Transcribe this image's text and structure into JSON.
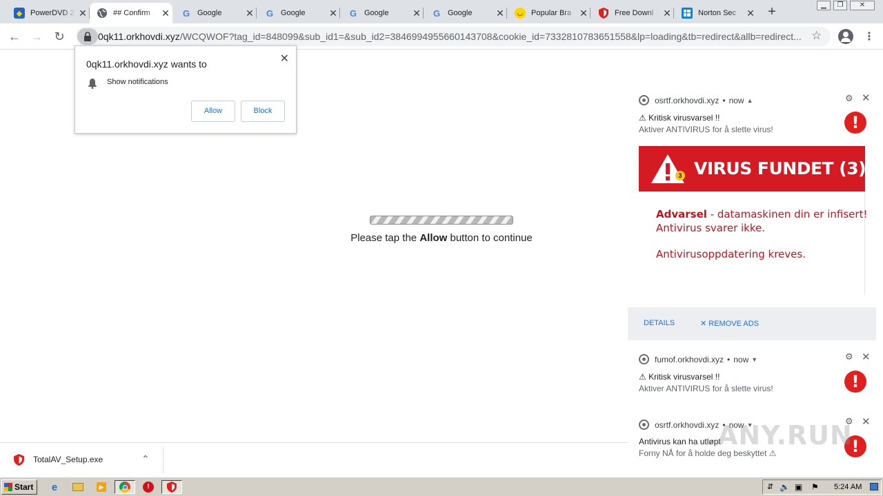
{
  "browser": {
    "tabs": [
      {
        "title": "PowerDVD 2",
        "icon": "powerdvd-icon"
      },
      {
        "title": "## Confirm",
        "icon": "globe-icon",
        "active": true
      },
      {
        "title": "Google",
        "icon": "google-icon"
      },
      {
        "title": "Google",
        "icon": "google-icon"
      },
      {
        "title": "Google",
        "icon": "google-icon"
      },
      {
        "title": "Google",
        "icon": "google-icon"
      },
      {
        "title": "Popular Bra",
        "icon": "smiley-icon"
      },
      {
        "title": "Free Downl",
        "icon": "shield-icon"
      },
      {
        "title": "Norton Sec",
        "icon": "windows-icon"
      }
    ],
    "new_tab": "+",
    "url": {
      "host": "0qk11.orkhovdi.xyz",
      "path": "/WCQWOF?tag_id=848099&sub_id1=&sub_id2=3846994955660143708&cookie_id=7332810783651558&lp=loading&tb=redirect&allb=redirect..."
    }
  },
  "permission_prompt": {
    "title": "0qk11.orkhovdi.xyz wants to",
    "description": "Show notifications",
    "allow_label": "Allow",
    "block_label": "Block"
  },
  "page": {
    "message_before": "Please tap the ",
    "message_bold": "Allow",
    "message_after": " button to continue"
  },
  "notifications": [
    {
      "source": "osrtf.orkhovdi.xyz",
      "time": "now",
      "title": "⚠ Kritisk virusvarsel !!",
      "body": "Aktiver ANTIVIRUS for å slette virus!",
      "image": {
        "banner": "VIRUS FUNDET (3)",
        "badge": "3",
        "warning_bold": "Advarsel",
        "warning_rest": " - datamaskinen din er infisert!",
        "line2": "Antivirus svarer ikke.",
        "line3": "Antivirusoppdatering kreves."
      },
      "actions": {
        "details": "DETAILS",
        "remove_ads": "REMOVE ADS"
      }
    },
    {
      "source": "fumof.orkhovdi.xyz",
      "time": "now",
      "title": "⚠ Kritisk virusvarsel !!",
      "body": "Aktiver ANTIVIRUS for å slette virus!"
    },
    {
      "source": "osrtf.orkhovdi.xyz",
      "time": "now",
      "title": "Antivirus kan ha utløpt",
      "body": "Forny NÅ for å holde deg beskyttet ⚠"
    }
  ],
  "download": {
    "filename": "TotalAV_Setup.exe"
  },
  "watermark": "ANY.RUN",
  "taskbar": {
    "start_label": "Start",
    "clock": "5:24 AM"
  },
  "colors": {
    "alert_red": "#e0201e",
    "banner_red": "#d41a23",
    "link_blue": "#1a73e8"
  }
}
